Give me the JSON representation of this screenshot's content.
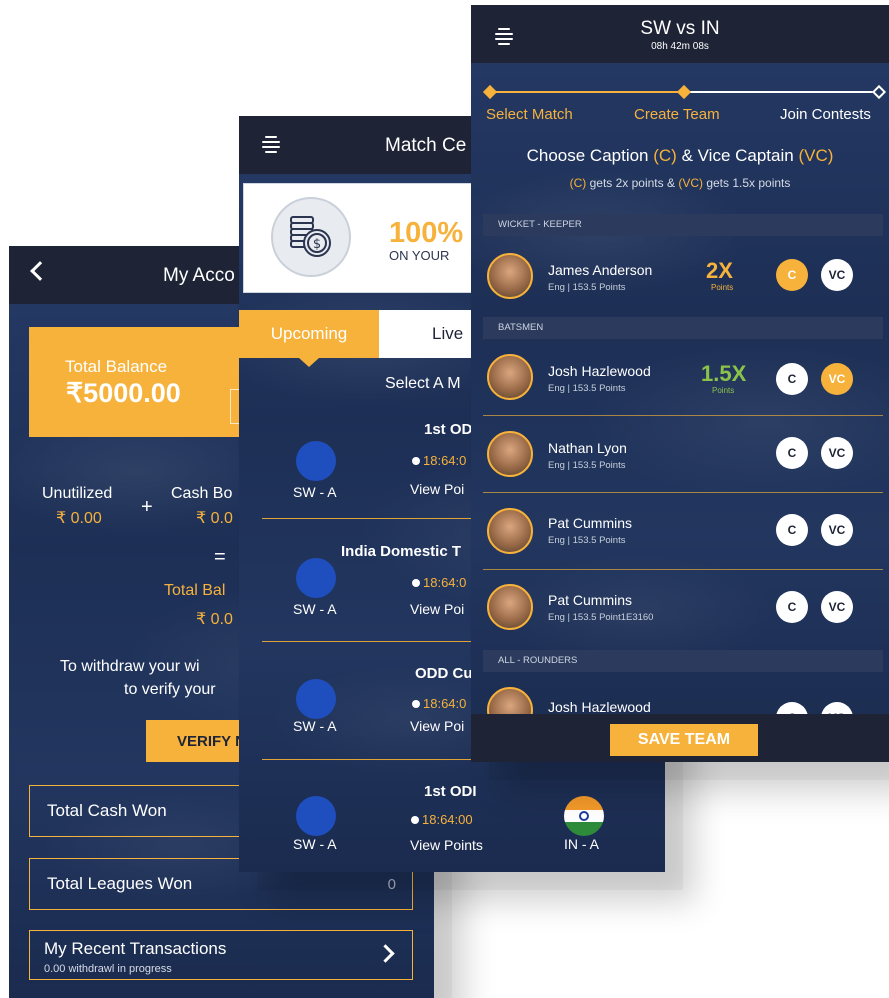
{
  "account": {
    "title": "My Acco",
    "balance_label": "Total Balance",
    "balance_value": "₹5000.00",
    "unutilized_label": "Unutilized",
    "unutilized_value": "₹ 0.00",
    "plus": "+",
    "cash_bonus_label": "Cash Bo",
    "cash_bonus_value": "₹ 0.0",
    "equals": "=",
    "total_bal_label": "Total Bal",
    "total_bal_value": "₹ 0.0",
    "withdraw_line1": "To withdraw your wi",
    "withdraw_line2": "to verify your",
    "verify_button": "VERIFY N",
    "total_cash_won_label": "Total Cash Won",
    "total_leagues_won_label": "Total Leagues Won",
    "total_leagues_won_value": "0",
    "recent_title": "My Recent Transactions",
    "recent_sub": "0.00 withdrawl in progress"
  },
  "match_center": {
    "title": "Match Ce",
    "promo_big": "100%",
    "promo_small": "ON YOUR",
    "tab_upcoming": "Upcoming",
    "tab_live": "Live",
    "select_match": "Select A M",
    "matches": [
      {
        "name": "1st OD",
        "team1": "SW - A",
        "timer": "18:64:0",
        "view": "View Poi"
      },
      {
        "name": "India Domestic T",
        "team1": "SW - A",
        "timer": "18:64:0",
        "view": "View Poi"
      },
      {
        "name": "ODD Cu",
        "team1": "SW - A",
        "timer": "18:64:0",
        "view": "View Poi"
      },
      {
        "name": "1st ODI",
        "team1": "SW - A",
        "team2": "IN - A",
        "timer": "18:64:00",
        "view": "View Points"
      }
    ]
  },
  "team": {
    "title": "SW vs IN",
    "countdown": "08h 42m 08s",
    "steps": [
      "Select Match",
      "Create Team",
      "Join Contests"
    ],
    "choose_pre": "Choose Caption ",
    "choose_c": "(C)",
    "choose_mid": " & Vice Captain ",
    "choose_vc": "(VC)",
    "sub_c": "(C)",
    "sub_mid": " gets 2x points & ",
    "sub_vc": "(VC)",
    "sub_end": " gets 1.5x points",
    "sections": [
      "WICKET - KEEPER",
      "BATSMEN",
      "ALL - ROUNDERS"
    ],
    "players": [
      {
        "name": "James Anderson",
        "meta": "Eng | 153.5 Points",
        "mult": "2X",
        "mult_sub": "Points"
      },
      {
        "name": "Josh Hazlewood",
        "meta": "Eng | 153.5 Points",
        "mult": "1.5X",
        "mult_sub": "Points"
      },
      {
        "name": "Nathan Lyon",
        "meta": "Eng | 153.5 Points"
      },
      {
        "name": "Pat Cummins",
        "meta": "Eng | 153.5 Points"
      },
      {
        "name": "Pat Cummins",
        "meta": "Eng | 153.5 Point1E3160"
      },
      {
        "name": "Josh Hazlewood"
      }
    ],
    "c_label": "C",
    "vc_label": "VC",
    "save_button": "SAVE TEAM"
  },
  "colors": {
    "accent": "#f6b23b",
    "header": "#1e2436",
    "background": "#22365f",
    "multiplier_green": "#8bc34a"
  }
}
